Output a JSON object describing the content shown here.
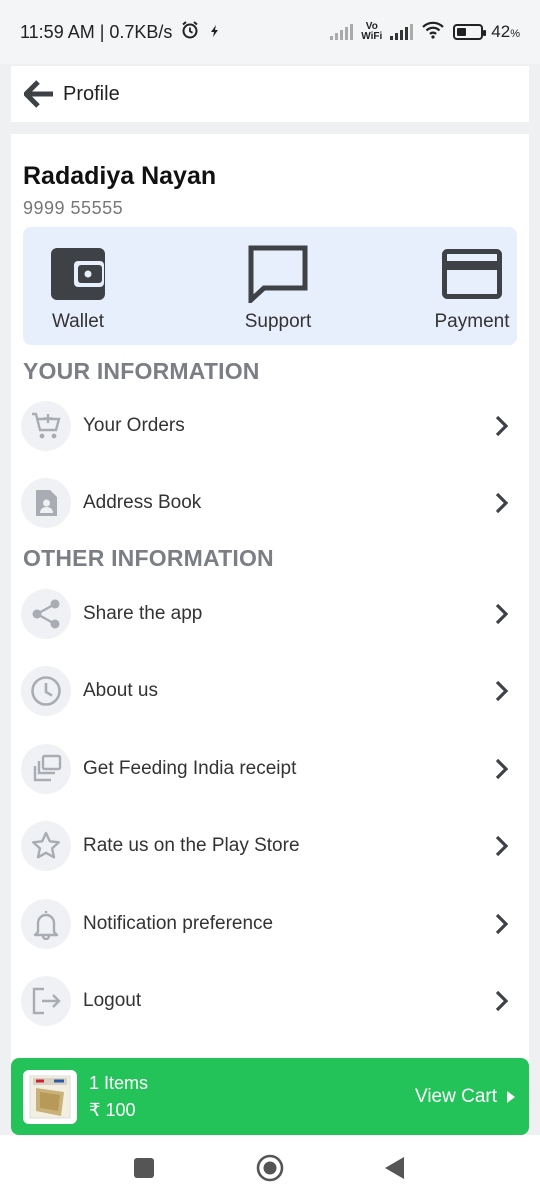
{
  "status_bar": {
    "time_speed": "11:59 AM | 0.7KB/s",
    "vowifi_top": "Vo",
    "vowifi_bottom": "WiFi",
    "battery": "42",
    "battery_suffix": "%",
    "battery_level": 0.42
  },
  "app_bar": {
    "title": "Profile"
  },
  "user": {
    "name": "Radadiya Nayan",
    "phone": "9999 55555"
  },
  "quick_actions": [
    {
      "label": "Wallet",
      "icon": "wallet-icon"
    },
    {
      "label": "Support",
      "icon": "chat-bubble-icon"
    },
    {
      "label": "Payment",
      "icon": "credit-card-icon"
    }
  ],
  "sections": {
    "your_information": "YOUR INFORMATION",
    "other_information": "OTHER INFORMATION"
  },
  "your_info_items": [
    {
      "label": "Your Orders",
      "icon": "cart-add-icon"
    },
    {
      "label": "Address Book",
      "icon": "contact-book-icon"
    }
  ],
  "other_info_items": [
    {
      "label": "Share the app",
      "icon": "share-icon"
    },
    {
      "label": "About us",
      "icon": "clock-icon"
    },
    {
      "label": "Get Feeding India receipt",
      "icon": "receipt-stack-icon"
    },
    {
      "label": "Rate us on the Play Store",
      "icon": "star-icon"
    },
    {
      "label": "Notification preference",
      "icon": "bell-icon"
    },
    {
      "label": "Logout",
      "icon": "logout-icon"
    }
  ],
  "cart": {
    "items": "1 Items",
    "price": "₹ 100",
    "view_cart": "View Cart"
  },
  "colors": {
    "accent_green": "#23c35a",
    "quick_actions_bg": "#e8effc",
    "section_heading": "#7b7e85",
    "icon_dark": "#3e4145"
  }
}
